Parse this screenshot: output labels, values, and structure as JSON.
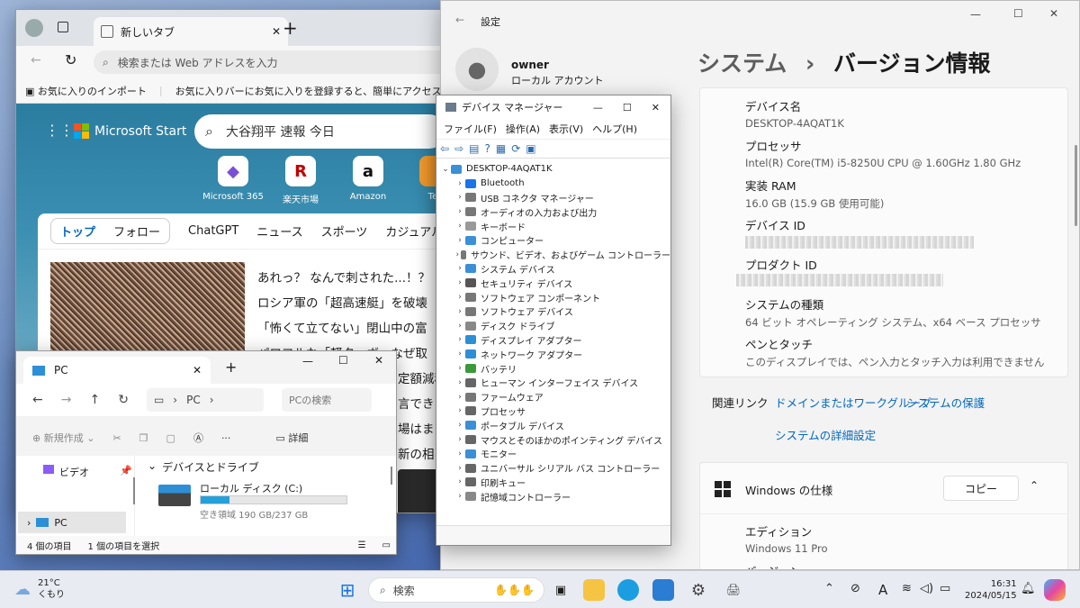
{
  "edge": {
    "tab_title": "新しいタブ",
    "address_placeholder": "検索または Web アドレスを入力",
    "favorites": [
      "お気に入りのインポート",
      "お気に入りバーにお気に入りを登録すると、簡単にアクセスできるようになります。"
    ],
    "brand": "Microsoft Start",
    "search_value": "大谷翔平 速報 今日",
    "quick_links": [
      "Microsoft 365",
      "楽天市場",
      "Amazon",
      "Ter"
    ],
    "feed_tabs": [
      "トップ",
      "フォロー",
      "ChatGPT",
      "ニュース",
      "スポーツ",
      "カジュアル ゲー"
    ],
    "headlines": [
      "あれっ？ なんで刺された...！？",
      "ロシア軍の「超高速艇」を破壊",
      "「怖くて立てない」閉山中の富",
      "パワフルな「軽ターボ」なぜ取",
      "定額減税",
      "言でき",
      "場はま",
      "新の相"
    ]
  },
  "settings": {
    "app_title": "設定",
    "user_name": "owner",
    "user_type": "ローカル アカウント",
    "breadcrumb_root": "システム",
    "breadcrumb_sep": "›",
    "breadcrumb_page": "バージョン情報",
    "specs": [
      {
        "label": "デバイス名",
        "value": "DESKTOP-4AQAT1K"
      },
      {
        "label": "プロセッサ",
        "value": "Intel(R) Core(TM) i5-8250U CPU @ 1.60GHz   1.80 GHz"
      },
      {
        "label": "実装 RAM",
        "value": "16.0 GB (15.9 GB 使用可能)"
      },
      {
        "label": "デバイス ID",
        "value": ""
      },
      {
        "label": "プロダクト ID",
        "value": ""
      },
      {
        "label": "システムの種類",
        "value": "64 ビット オペレーティング システム、x64 ベース プロセッサ"
      },
      {
        "label": "ペンとタッチ",
        "value": "このディスプレイでは、ペン入力とタッチ入力は利用できません"
      }
    ],
    "related_links_label": "関連リンク",
    "related_links": [
      "ドメインまたはワークグループ",
      "システムの保護",
      "システムの詳細設定"
    ],
    "windows_spec_title": "Windows の仕様",
    "copy_button": "コピー",
    "edition_label": "エディション",
    "edition_value": "Windows 11 Pro",
    "version_label": "バージョン"
  },
  "devmgr": {
    "title": "デバイス マネージャー",
    "menu": [
      "ファイル(F)",
      "操作(A)",
      "表示(V)",
      "ヘルプ(H)"
    ],
    "root": "DESKTOP-4AQAT1K",
    "items": [
      "Bluetooth",
      "USB コネクタ マネージャー",
      "オーディオの入力および出力",
      "キーボード",
      "コンピューター",
      "サウンド、ビデオ、およびゲーム コントローラー",
      "システム デバイス",
      "セキュリティ デバイス",
      "ソフトウェア コンポーネント",
      "ソフトウェア デバイス",
      "ディスク ドライブ",
      "ディスプレイ アダプター",
      "ネットワーク アダプター",
      "バッテリ",
      "ヒューマン インターフェイス デバイス",
      "ファームウェア",
      "プロセッサ",
      "ポータブル デバイス",
      "マウスとそのほかのポインティング デバイス",
      "モニター",
      "ユニバーサル シリアル バス コントローラー",
      "印刷キュー",
      "記憶域コントローラー"
    ],
    "item_colors": [
      "#1a73e8",
      "#777",
      "#777",
      "#999",
      "#3b8fd6",
      "#777",
      "#3b8fd6",
      "#555",
      "#777",
      "#777",
      "#888",
      "#2d8fd6",
      "#2d8fd6",
      "#3a9a3a",
      "#666",
      "#777",
      "#666",
      "#3b8fd6",
      "#666",
      "#3b8fd6",
      "#666",
      "#666",
      "#888"
    ]
  },
  "explorer": {
    "tab_title": "PC",
    "path": "PC",
    "search_placeholder": "PCの検索",
    "new_button": "新規作成",
    "details_button": "詳細",
    "nav_items": [
      "ビデオ",
      "PC"
    ],
    "section_title": "デバイスとドライブ",
    "drive_name": "ローカル ディスク (C:)",
    "drive_free": "空き領域 190 GB/237 GB",
    "drive_used_fraction": 0.2,
    "status_items": "4 個の項目",
    "status_selected": "1 個の項目を選択"
  },
  "taskbar": {
    "weather_temp": "21°C",
    "weather_desc": "くもり",
    "search_placeholder": "検索",
    "ime": "A",
    "time": "16:31",
    "date": "2024/05/15"
  }
}
